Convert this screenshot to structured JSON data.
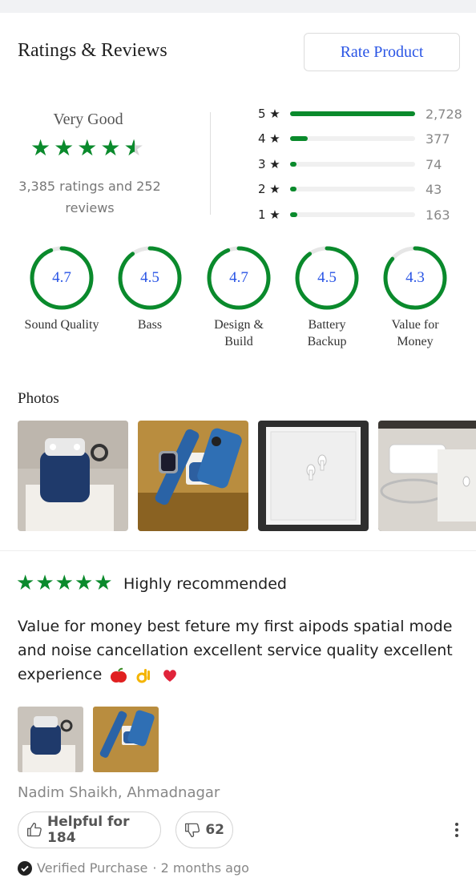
{
  "header": {
    "title": "Ratings & Reviews",
    "rate_button": "Rate Product"
  },
  "summary": {
    "verdict": "Very Good",
    "star_rating": 4.6,
    "count_text": "3,385 ratings and 252 reviews"
  },
  "distribution": [
    {
      "label": "5 ★",
      "count": "2,728",
      "fraction": 1.0
    },
    {
      "label": "4 ★",
      "count": "377",
      "fraction": 0.14
    },
    {
      "label": "3 ★",
      "count": "74",
      "fraction": 0.03
    },
    {
      "label": "2 ★",
      "count": "43",
      "fraction": 0.02
    },
    {
      "label": "1 ★",
      "count": "163",
      "fraction": 0.06
    }
  ],
  "aspects": [
    {
      "score": "4.7",
      "name": "Sound Quality",
      "fraction": 0.94
    },
    {
      "score": "4.5",
      "name": "Bass",
      "fraction": 0.9
    },
    {
      "score": "4.7",
      "name": "Design & Build",
      "fraction": 0.94
    },
    {
      "score": "4.5",
      "name": "Battery Backup",
      "fraction": 0.9
    },
    {
      "score": "4.3",
      "name": "Value for Money",
      "fraction": 0.86
    }
  ],
  "photos": {
    "title": "Photos"
  },
  "review": {
    "stars": 5,
    "title": "Highly recommended",
    "body": "Value for money best feture my first aipods spatial mode and noise cancellation excellent service quality excellent experience",
    "emojis": [
      "red-apple-emoji",
      "ok-hand-emoji",
      "red-heart-emoji"
    ],
    "reviewer": "Nadim Shaikh, Ahmadnagar",
    "helpful_label": "Helpful for 184",
    "unhelpful_count": "62",
    "verified": "Verified Purchase",
    "time": "· 2 months ago"
  },
  "colors": {
    "accent_green": "#0a8a2c",
    "link_blue": "#2a55e5",
    "track_gray": "#f0f0f0"
  }
}
